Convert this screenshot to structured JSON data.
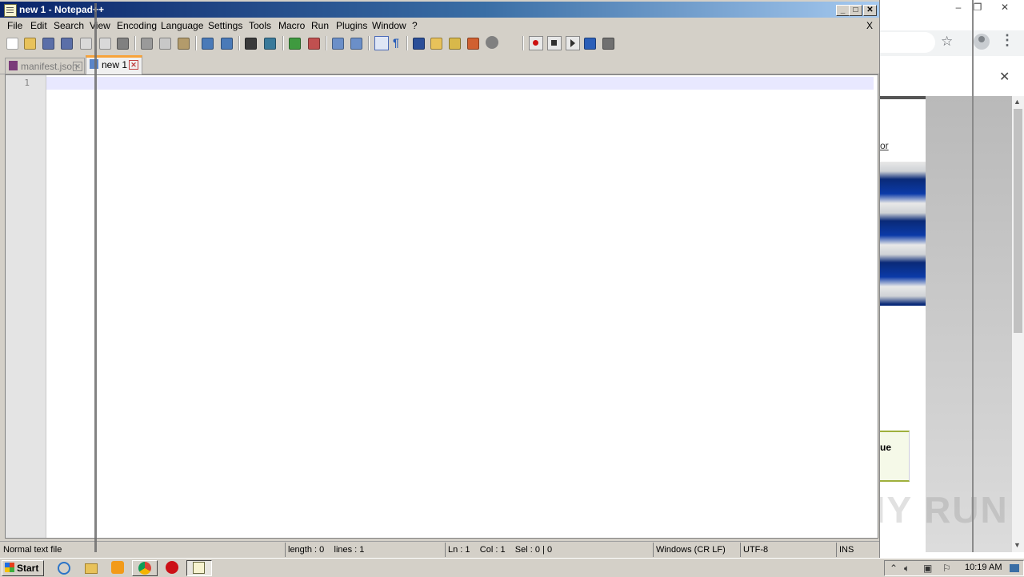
{
  "notepad": {
    "title": "new 1 - Notepad++",
    "menu": [
      "File",
      "Edit",
      "Search",
      "View",
      "Encoding",
      "Language",
      "Settings",
      "Tools",
      "Macro",
      "Run",
      "Plugins",
      "Window",
      "?"
    ],
    "menu_close": "X",
    "tabs": [
      {
        "label": "manifest.json",
        "active": false
      },
      {
        "label": "new 1",
        "active": true
      }
    ],
    "editor": {
      "line_numbers": [
        "1"
      ],
      "content": ""
    },
    "status": {
      "file_type": "Normal text file",
      "length": "length : 0",
      "lines": "lines : 1",
      "ln": "Ln : 1",
      "col": "Col : 1",
      "sel": "Sel : 0 | 0",
      "eol": "Windows (CR LF)",
      "encoding": "UTF-8",
      "mode": "INS"
    },
    "toolbar_icons": [
      "new-file-icon",
      "open-file-icon",
      "save-icon",
      "save-all-icon",
      "close-icon",
      "close-all-icon",
      "print-icon",
      "cut-icon",
      "copy-icon",
      "paste-icon",
      "undo-icon",
      "redo-icon",
      "find-icon",
      "replace-icon",
      "zoom-in-icon",
      "zoom-out-icon",
      "sync-vertical-icon",
      "sync-horizontal-icon",
      "word-wrap-icon",
      "show-all-chars-icon",
      "indent-guide-icon",
      "doc-map-icon",
      "function-list-icon",
      "folder-workspace-icon",
      "monitoring-icon",
      "record-macro-icon",
      "stop-record-icon",
      "play-macro-icon",
      "run-macro-multiple-icon",
      "save-macro-icon"
    ]
  },
  "browser": {
    "link_fragment": "or",
    "card_text": "ue",
    "watermark": "ANY RUN"
  },
  "taskbar": {
    "start_label": "Start",
    "clock": "10:19 AM"
  },
  "colors": {
    "title_gradient_start": "#0a246a",
    "active_tab_accent": "#f8a33a",
    "current_line": "#e8e8ff"
  }
}
